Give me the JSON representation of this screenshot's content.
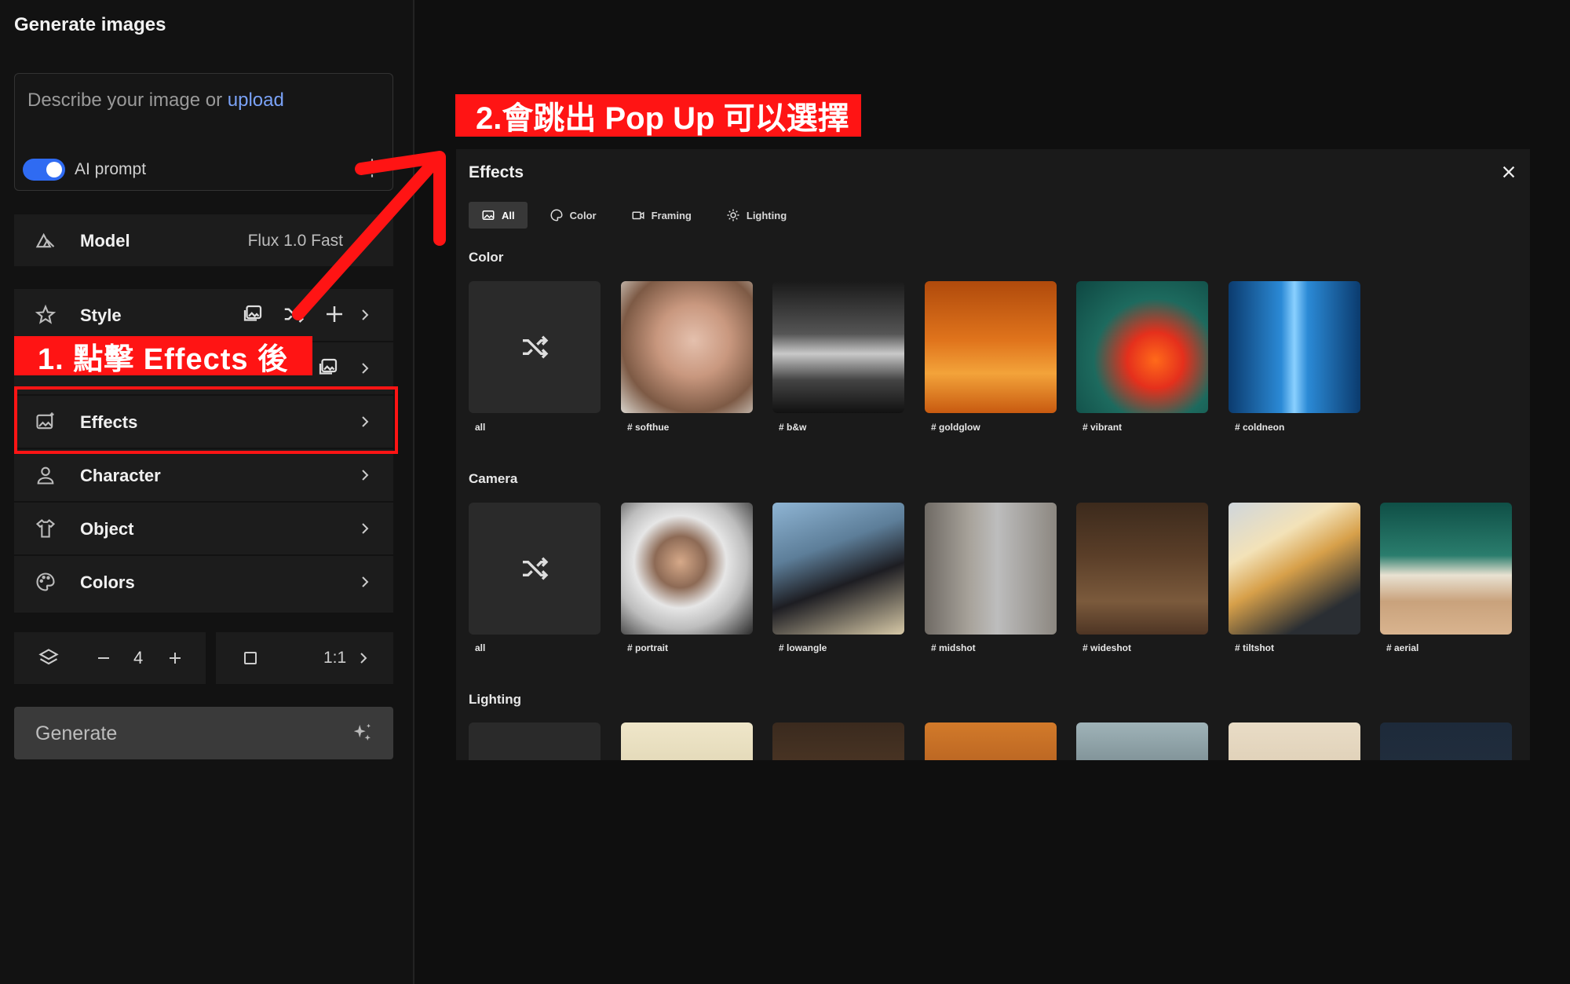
{
  "app": {
    "title": "Generate images"
  },
  "prompt": {
    "placeholder": "Describe your image or",
    "upload_link": "upload",
    "ai_toggle_label": "AI prompt",
    "ai_toggle_on": true
  },
  "model": {
    "label": "Model",
    "value": "Flux 1.0 Fast"
  },
  "sidebar_rows": [
    {
      "label": "Style"
    },
    {
      "label": ""
    },
    {
      "label": "Effects"
    },
    {
      "label": "Character"
    },
    {
      "label": "Object"
    },
    {
      "label": "Colors"
    }
  ],
  "controls": {
    "count": "4",
    "aspect_ratio": "1:1"
  },
  "generate": {
    "label": "Generate"
  },
  "annotations": {
    "step1": "1. 點擊 Effects 後",
    "step2": "2.會跳出 Pop Up 可以選擇"
  },
  "modal": {
    "title": "Effects",
    "tabs": [
      "All",
      "Color",
      "Framing",
      "Lighting"
    ],
    "active_tab": "All",
    "sections": [
      {
        "title": "Color",
        "items": [
          "all",
          "# softhue",
          "# b&w",
          "# goldglow",
          "# vibrant",
          "# coldneon"
        ]
      },
      {
        "title": "Camera",
        "items": [
          "all",
          "# portrait",
          "# lowangle",
          "# midshot",
          "# wideshot",
          "# tiltshot",
          "# aerial"
        ]
      },
      {
        "title": "Lighting",
        "items": [
          "",
          "",
          "",
          "",
          "",
          "",
          ""
        ]
      }
    ]
  },
  "colors": {
    "accent_red": "#ff1414",
    "toggle_blue": "#2f6bf2",
    "link_blue": "#7aa2f7"
  }
}
